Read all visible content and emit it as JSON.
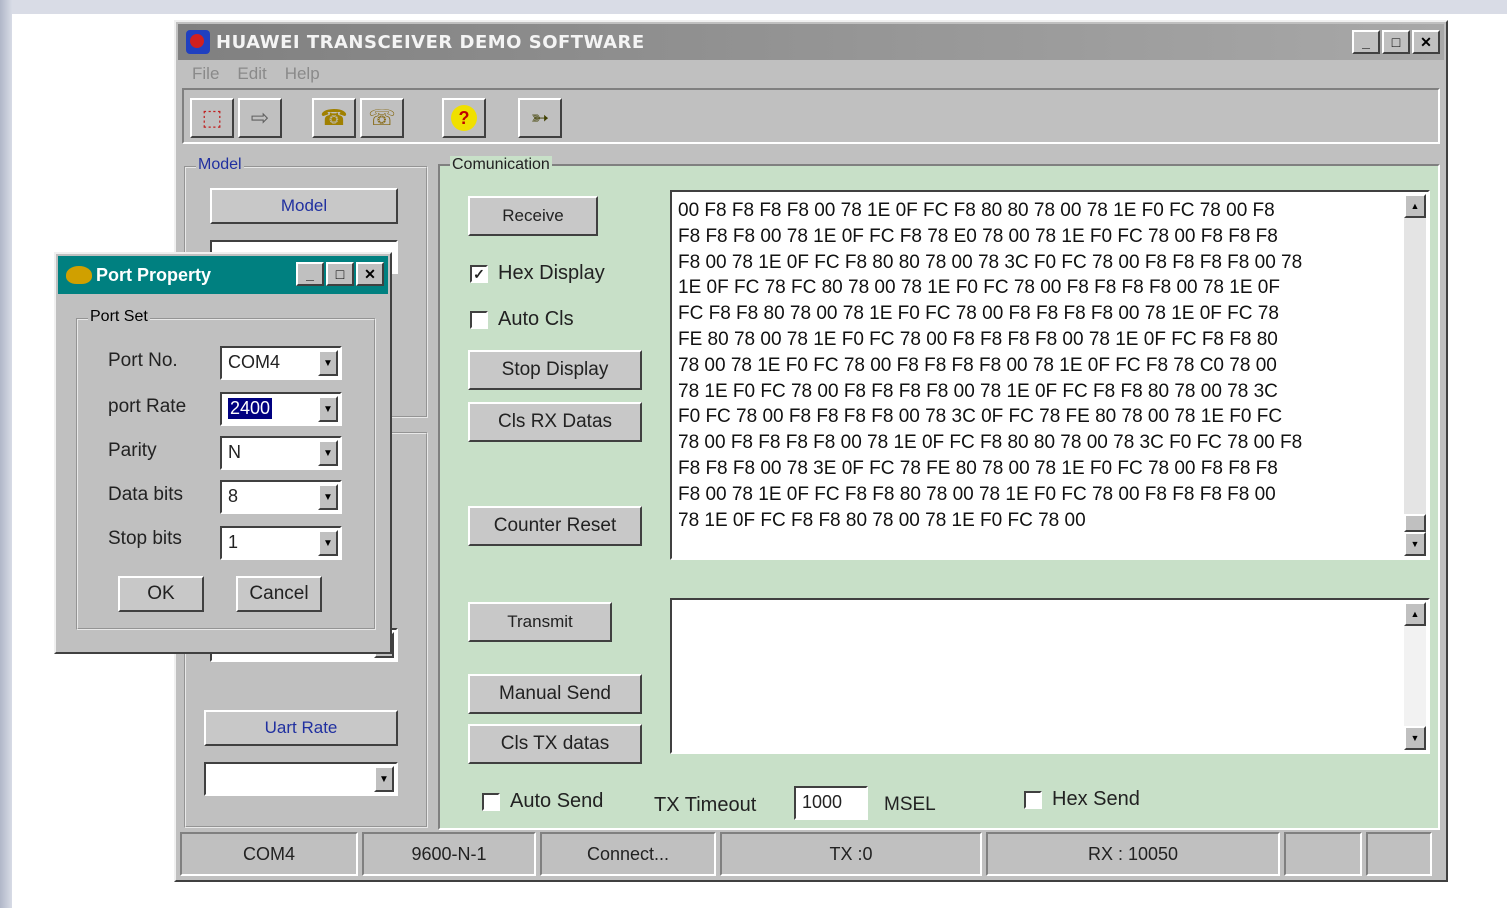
{
  "window": {
    "title": "HUAWEI TRANSCEIVER DEMO SOFTWARE"
  },
  "menu": [
    "File",
    "Edit",
    "Help"
  ],
  "left_panel": {
    "model_group": "Model",
    "model_button": "Model",
    "uart_button": "Uart Rate",
    "uart_value": ""
  },
  "comm": {
    "group": "Comunication",
    "receive_label": "Receive",
    "hex_display": "Hex Display",
    "auto_cls": "Auto Cls",
    "stop_display": "Stop Display",
    "cls_rx": "Cls RX Datas",
    "counter_reset": "Counter Reset",
    "transmit_label": "Transmit",
    "manual_send": "Manual Send",
    "cls_tx": "Cls TX datas",
    "auto_send": "Auto Send",
    "tx_timeout_label": "TX Timeout",
    "tx_timeout_value": "1000",
    "unit": "MSEL",
    "hex_send": "Hex Send",
    "rx_lines": [
      "00 F8 F8 F8 F8 00 78 1E 0F FC F8 80 80 78 00 78 1E F0 FC 78 00 F8",
      "F8 F8 F8 00 78 1E 0F FC F8 78 E0 78 00 78 1E F0 FC 78 00 F8 F8 F8",
      "F8 00 78 1E 0F FC F8 80 80 78 00 78 3C F0 FC 78 00 F8 F8 F8 F8 00 78",
      "1E 0F FC 78 FC 80 78 00 78 1E F0 FC 78 00 F8 F8 F8 F8 00 78 1E 0F",
      "FC F8 F8 80 78 00 78 1E F0 FC 78 00 F8 F8 F8 F8 00 78 1E 0F FC 78",
      "FE 80 78 00 78 1E F0 FC 78 00 F8 F8 F8 F8 00 78 1E 0F FC F8 F8 80",
      "78 00 78 1E F0 FC 78 00 F8 F8 F8 F8 00 78 1E 0F FC F8 78 C0 78 00",
      "78 1E F0 FC 78 00 F8 F8 F8 F8 00 78 1E 0F FC F8 F8 80 78 00 78 3C",
      "F0 FC 78 00 F8 F8 F8 F8 00 78 3C 0F FC 78 FE 80 78 00 78 1E F0 FC",
      "78 00 F8 F8 F8 F8 00 78 1E 0F FC F8 80 80 78 00 78 3C F0 FC 78 00 F8",
      "F8 F8 F8 00 78 3E 0F FC 78 FE 80 78 00 78 1E F0 FC 78 00 F8 F8 F8",
      "F8 00 78 1E 0F FC F8 F8 80 78 00 78 1E F0 FC 78 00 F8 F8 F8 F8 00",
      "78 1E 0F FC F8 F8 80 78 00 78 1E F0 FC 78 00"
    ]
  },
  "status": {
    "port": "COM4",
    "config": "9600-N-1",
    "conn": "Connect...",
    "tx": "TX :0",
    "rx": "RX : 10050"
  },
  "dialog": {
    "title": "Port Property",
    "group": "Port Set",
    "port_no_label": "Port No.",
    "port_no": "COM4",
    "port_rate_label": "port Rate",
    "port_rate": "2400",
    "parity_label": "Parity",
    "parity": "N",
    "data_bits_label": "Data bits",
    "data_bits": "8",
    "stop_bits_label": "Stop bits",
    "stop_bits": "1",
    "ok": "OK",
    "cancel": "Cancel"
  },
  "icons": [
    "open-file-icon",
    "export-icon",
    "phone-connect-icon",
    "phone-hangup-icon",
    "help-icon",
    "exit-icon"
  ]
}
